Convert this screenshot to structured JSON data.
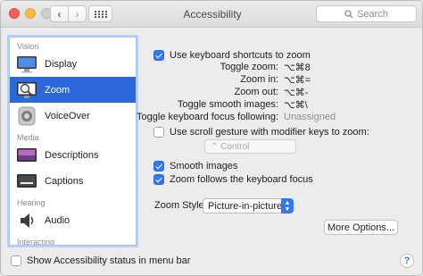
{
  "window": {
    "title": "Accessibility"
  },
  "toolbar": {
    "search_placeholder": "Search"
  },
  "sidebar": {
    "sections": {
      "vision": "Vision",
      "media": "Media",
      "hearing": "Hearing",
      "interacting": "Interacting"
    },
    "items": [
      {
        "label": "Display",
        "icon": "display-icon"
      },
      {
        "label": "Zoom",
        "icon": "zoom-icon",
        "selected": true
      },
      {
        "label": "VoiceOver",
        "icon": "voiceover-icon"
      },
      {
        "label": "Descriptions",
        "icon": "descriptions-icon"
      },
      {
        "label": "Captions",
        "icon": "captions-icon"
      },
      {
        "label": "Audio",
        "icon": "audio-icon"
      }
    ]
  },
  "zoom": {
    "keyboard_shortcuts": {
      "label": "Use keyboard shortcuts to zoom",
      "checked": true
    },
    "shortcuts": [
      {
        "name": "Toggle zoom:",
        "value": "⌥⌘8"
      },
      {
        "name": "Zoom in:",
        "value": "⌥⌘="
      },
      {
        "name": "Zoom out:",
        "value": "⌥⌘-"
      },
      {
        "name": "Toggle smooth images:",
        "value": "⌥⌘\\"
      },
      {
        "name": "Toggle keyboard focus following:",
        "value": "Unassigned"
      }
    ],
    "scroll_gesture": {
      "label": "Use scroll gesture with modifier keys to zoom:",
      "checked": false
    },
    "modifier_popup": {
      "value": "⌃ Control"
    },
    "smooth_images": {
      "label": "Smooth images",
      "checked": true
    },
    "follow_focus": {
      "label": "Zoom follows the keyboard focus",
      "checked": true
    },
    "zoom_style": {
      "label": "Zoom Style:",
      "value": "Picture-in-picture"
    },
    "more_options": "More Options..."
  },
  "footer": {
    "show_status": {
      "label": "Show Accessibility status in menu bar",
      "checked": false
    },
    "help": "?"
  },
  "colors": {
    "selection": "#2b68d9",
    "checkbox_on": "#3478f6",
    "close": "#fc605c",
    "minimize": "#fdbc40"
  }
}
